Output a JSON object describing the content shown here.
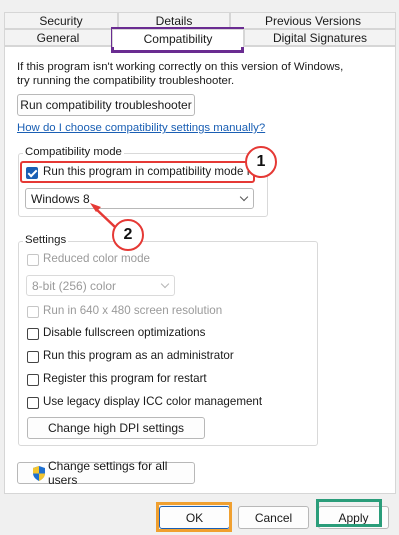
{
  "tabs": {
    "row1": [
      "Security",
      "Details",
      "Previous Versions"
    ],
    "row2": [
      "General",
      "Compatibility",
      "Digital Signatures"
    ]
  },
  "intro_text": [
    "If this program isn't working correctly on this version of Windows,",
    "try running the compatibility troubleshooter."
  ],
  "troubleshooter_button": "Run compatibility troubleshooter",
  "help_link": "How do I choose compatibility settings manually?",
  "compat_mode": {
    "group_label": "Compatibility mode",
    "checkbox_label": "Run this program in compatibility mode for:",
    "checked": true,
    "selected_os": "Windows 8"
  },
  "settings": {
    "group_label": "Settings",
    "reduced_color": {
      "label": "Reduced color mode",
      "checked": false,
      "enabled": false
    },
    "color_depth": "8-bit (256) color",
    "resolution_640": {
      "label": "Run in 640 x 480 screen resolution",
      "checked": false,
      "enabled": false
    },
    "disable_fullscreen": {
      "label": "Disable fullscreen optimizations",
      "checked": false,
      "enabled": true
    },
    "run_as_admin": {
      "label": "Run this program as an administrator",
      "checked": false,
      "enabled": true
    },
    "register_restart": {
      "label": "Register this program for restart",
      "checked": false,
      "enabled": true
    },
    "legacy_icc": {
      "label": "Use legacy display ICC color management",
      "checked": false,
      "enabled": true
    },
    "dpi_button": "Change high DPI settings"
  },
  "all_users_button": "Change settings for all users",
  "footer": {
    "ok": "OK",
    "cancel": "Cancel",
    "apply": "Apply"
  },
  "annotations": {
    "marker_1": "1",
    "marker_2": "2",
    "tab_highlight_color": "#6a2c91",
    "checkbox_highlight_color": "#e53935",
    "ok_highlight_color": "#f0a030",
    "apply_highlight_color": "#2a9d7a"
  },
  "colors": {
    "accent": "#1a5fb4",
    "link": "#1a5fb4"
  }
}
